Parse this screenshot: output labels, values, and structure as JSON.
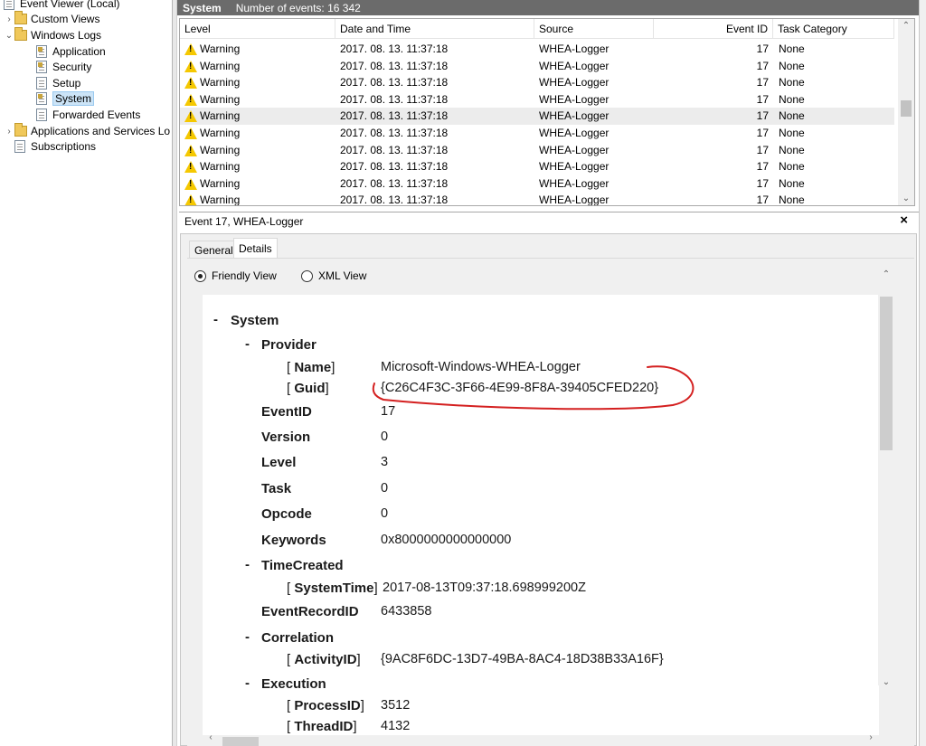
{
  "tree": {
    "root": "Event Viewer (Local)",
    "custom_views": "Custom Views",
    "windows_logs": "Windows Logs",
    "application": "Application",
    "security": "Security",
    "setup": "Setup",
    "system": "System",
    "forwarded": "Forwarded Events",
    "app_services": "Applications and Services Lo",
    "subscriptions": "Subscriptions"
  },
  "logbar": {
    "name": "System",
    "count": "Number of events: 16 342"
  },
  "grid": {
    "columns": [
      "Level",
      "Date and Time",
      "Source",
      "Event ID",
      "Task Category"
    ],
    "rows": [
      {
        "level": "Warning",
        "date": "2017. 08. 13. 11:37:18",
        "source": "WHEA-Logger",
        "id": "17",
        "cat": "None"
      },
      {
        "level": "Warning",
        "date": "2017. 08. 13. 11:37:18",
        "source": "WHEA-Logger",
        "id": "17",
        "cat": "None"
      },
      {
        "level": "Warning",
        "date": "2017. 08. 13. 11:37:18",
        "source": "WHEA-Logger",
        "id": "17",
        "cat": "None"
      },
      {
        "level": "Warning",
        "date": "2017. 08. 13. 11:37:18",
        "source": "WHEA-Logger",
        "id": "17",
        "cat": "None"
      },
      {
        "level": "Warning",
        "date": "2017. 08. 13. 11:37:18",
        "source": "WHEA-Logger",
        "id": "17",
        "cat": "None"
      },
      {
        "level": "Warning",
        "date": "2017. 08. 13. 11:37:18",
        "source": "WHEA-Logger",
        "id": "17",
        "cat": "None"
      },
      {
        "level": "Warning",
        "date": "2017. 08. 13. 11:37:18",
        "source": "WHEA-Logger",
        "id": "17",
        "cat": "None"
      },
      {
        "level": "Warning",
        "date": "2017. 08. 13. 11:37:18",
        "source": "WHEA-Logger",
        "id": "17",
        "cat": "None"
      },
      {
        "level": "Warning",
        "date": "2017. 08. 13. 11:37:18",
        "source": "WHEA-Logger",
        "id": "17",
        "cat": "None"
      },
      {
        "level": "Warning",
        "date": "2017. 08. 13. 11:37:18",
        "source": "WHEA-Logger",
        "id": "17",
        "cat": "None"
      }
    ]
  },
  "details": {
    "title": "Event 17, WHEA-Logger",
    "close": "×",
    "tabs": {
      "general": "General",
      "details": "Details"
    },
    "friendly_view": "Friendly View",
    "xml_view": "XML View",
    "friendly": {
      "system": "System",
      "provider": "Provider",
      "name_key": "Name",
      "name_val": "Microsoft-Windows-WHEA-Logger",
      "guid_key": "Guid",
      "guid_val": "{C26C4F3C-3F66-4E99-8F8A-39405CFED220}",
      "eventid_key": "EventID",
      "eventid_val": "17",
      "version_key": "Version",
      "version_val": "0",
      "level_key": "Level",
      "level_val": "3",
      "task_key": "Task",
      "task_val": "0",
      "opcode_key": "Opcode",
      "opcode_val": "0",
      "keywords_key": "Keywords",
      "keywords_val": "0x8000000000000000",
      "timecreated": "TimeCreated",
      "systemtime_key": "SystemTime",
      "systemtime_val": "2017-08-13T09:37:18.698999200Z",
      "recordid_key": "EventRecordID",
      "recordid_val": "6433858",
      "correlation": "Correlation",
      "activityid_key": "ActivityID",
      "activityid_val": "{9AC8F6DC-13D7-49BA-8AC4-18D38B33A16F}",
      "execution": "Execution",
      "processid_key": "ProcessID",
      "processid_val": "3512",
      "threadid_key": "ThreadID",
      "threadid_val": "4132"
    }
  },
  "colors": {
    "warning": "#f5c800",
    "annotation": "#d42020",
    "selection": "#cce4f7"
  },
  "icons": [
    "folder-icon",
    "log-icon",
    "warning-icon",
    "close-icon",
    "chevron-up-icon",
    "chevron-down-icon",
    "chevron-left-icon",
    "chevron-right-icon"
  ]
}
